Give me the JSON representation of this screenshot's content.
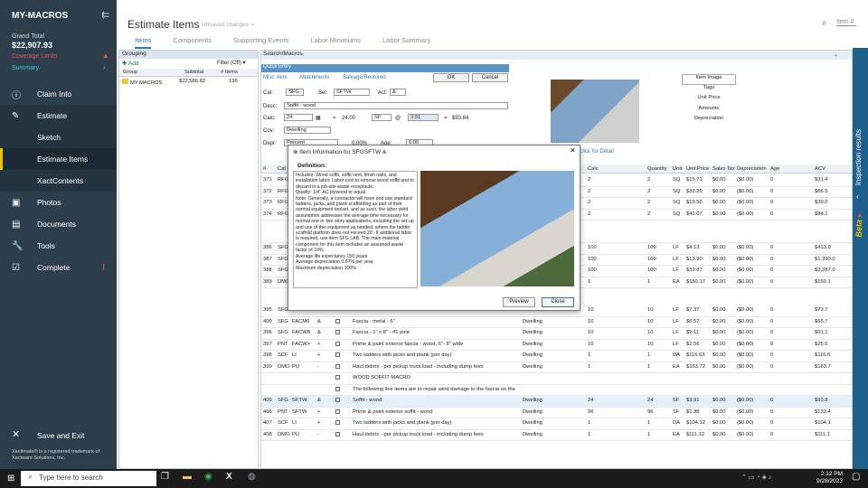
{
  "sidebar": {
    "app_title": "MY-MACROS",
    "collapse_icon": "⇇",
    "grand_total_label": "Grand Total",
    "grand_total_value": "$22,907.93",
    "coverage_limits": "Coverage Limits",
    "summary": "Summary",
    "items": [
      {
        "label": "Claim Info",
        "icon": "info-icon"
      },
      {
        "label": "Estimate",
        "icon": "pencil-icon"
      },
      {
        "label": "Sketch"
      },
      {
        "label": "Estimate Items"
      },
      {
        "label": "XactContents"
      },
      {
        "label": "Photos",
        "icon": "photos-icon"
      },
      {
        "label": "Documents",
        "icon": "documents-icon"
      },
      {
        "label": "Tools",
        "icon": "wrench-icon"
      },
      {
        "label": "Complete",
        "icon": "check-icon"
      }
    ],
    "save_exit": "Save and Exit",
    "trademark": "Xactimate® is a registered trademark of Xactware Solutions, Inc."
  },
  "header": {
    "title": "Estimate Items",
    "unsaved": "Unsaved changes",
    "tabs": [
      "Items",
      "Components",
      "Supporting Events",
      "Labor Minimums",
      "Labor Summary"
    ],
    "item_search_placeholder": "Item #"
  },
  "right_strip": {
    "inspection": "Inspection results",
    "beta": "Beta"
  },
  "grouping": {
    "title": "Grouping",
    "add": "Add",
    "filter": "Filter (Off)",
    "cols": [
      "Group",
      "Subtotal",
      "# Items"
    ],
    "row": {
      "group": "MY-MACROS",
      "subtotal": "$22,586.82",
      "items": "136"
    }
  },
  "search_macros": "Search/Macros",
  "quick_entry": {
    "title": "Quick Entry",
    "subtabs": [
      "Misc",
      "Item",
      "Attachments",
      "Salvage/Restored"
    ],
    "ok": "OK",
    "cancel": "Cancel",
    "cat_label": "Cat:",
    "cat": "SFG",
    "sel_label": "Sel:",
    "sel": "SFTW",
    "act_label": "Act:",
    "act": "&",
    "desc_label": "Desc:",
    "desc": "Soffit - wood",
    "calc_label": "Calc:",
    "calc": "24",
    "calc_result": "24.00",
    "unit": "SF",
    "at": "@",
    "price": "3.91",
    "eq": "=",
    "total": "$93.84",
    "cov_label": "Cov:",
    "cov": "Dwelling",
    "depr_label": "Depr:",
    "depr": "Percent",
    "depr_pct": "0.00%",
    "age_label": "Age:",
    "age": "0.00",
    "image_tabs": [
      "Item Image",
      "Tags",
      "Unit Price",
      "Amounts",
      "Depreciation"
    ],
    "click_detail": "Click for Detail"
  },
  "line_items": {
    "cols": [
      "#",
      "Cat",
      "Calc",
      "Quantity",
      "Unit",
      "Unit Price",
      "Sales Tax",
      "Depreciation",
      "Age",
      "ACV"
    ],
    "rows": [
      {
        "n": "371",
        "cat": "RFG",
        "calc": "2",
        "qty": "2",
        "unit": "SQ",
        "price": "$15.71",
        "tax": "$0.00",
        "dep": "($0.00)",
        "age": "0",
        "acv": "$31.4"
      },
      {
        "n": "372",
        "cat": "RFG",
        "calc": "2",
        "qty": "2",
        "unit": "SQ",
        "price": "$33.26",
        "tax": "$0.00",
        "dep": "($0.00)",
        "age": "0",
        "acv": "$66.5"
      },
      {
        "n": "373",
        "cat": "RFG",
        "calc": "2",
        "qty": "2",
        "unit": "SQ",
        "price": "$19.50",
        "tax": "$0.00",
        "dep": "($0.00)",
        "age": "0",
        "acv": "$39.0"
      },
      {
        "n": "374",
        "cat": "RFG",
        "calc": "2",
        "qty": "2",
        "unit": "SQ",
        "price": "$42.07",
        "tax": "$0.00",
        "dep": "($0.00)",
        "age": "0",
        "acv": "$84.1"
      },
      {
        "n": "",
        "cat": "",
        "calc": "",
        "qty": "",
        "unit": "",
        "price": "",
        "tax": "",
        "dep": "",
        "age": "",
        "acv": ""
      },
      {
        "n": "386",
        "cat": "SFG",
        "calc": "100",
        "qty": "100",
        "unit": "LF",
        "price": "$4.13",
        "tax": "$0.00",
        "dep": "($0.00)",
        "age": "0",
        "acv": "$413.0"
      },
      {
        "n": "387",
        "cat": "SFG",
        "calc": "100",
        "qty": "100",
        "unit": "LF",
        "price": "$13.90",
        "tax": "$0.00",
        "dep": "($0.00)",
        "age": "0",
        "acv": "$1,390.0"
      },
      {
        "n": "388",
        "cat": "SFG",
        "calc": "100",
        "qty": "100",
        "unit": "LF",
        "price": "$32.87",
        "tax": "$0.00",
        "dep": "($0.00)",
        "age": "0",
        "acv": "$3,287.0"
      },
      {
        "n": "389",
        "cat": "DMO",
        "calc": "1",
        "qty": "1",
        "unit": "EA",
        "price": "$150.17",
        "tax": "$0.00",
        "dep": "($0.00)",
        "age": "0",
        "acv": "$150.1"
      }
    ],
    "rows2": [
      {
        "n": "395",
        "cat": "SFG",
        "sel": "",
        "act": "",
        "desc": "",
        "calc": "10",
        "qty": "10",
        "unit": "LF",
        "price": "$7.37",
        "tax": "$0.00",
        "dep": "($0.00)",
        "age": "0",
        "acv": "$73.7"
      },
      {
        "n": "400",
        "cat": "SFG",
        "sel": "FACM6",
        "act": "&",
        "desc": "Fascia - metal - 6\"",
        "cov": "Dwelling",
        "calc": "10",
        "qty": "10",
        "unit": "LF",
        "price": "$6.57",
        "tax": "$0.00",
        "dep": "($0.00)",
        "age": "0",
        "acv": "$65.7"
      },
      {
        "n": "396",
        "cat": "SFG",
        "sel": "FACW8",
        "act": "&",
        "desc": "Fascia - 1\" x 8\" - #1 pine",
        "cov": "Dwelling",
        "calc": "10",
        "qty": "10",
        "unit": "LF",
        "price": "$9.11",
        "tax": "$0.00",
        "dep": "($0.00)",
        "age": "0",
        "acv": "$91.1"
      },
      {
        "n": "397",
        "cat": "PNT",
        "sel": "FACW>",
        "act": "+",
        "desc": "Prime & paint exterior fascia - wood, 6\"- 8\" wide",
        "cov": "Dwelling",
        "calc": "10",
        "qty": "10",
        "unit": "LF",
        "price": "$2.56",
        "tax": "$0.00",
        "dep": "($0.00)",
        "age": "0",
        "acv": "$25.6"
      },
      {
        "n": "398",
        "cat": "SCF",
        "sel": "LI",
        "act": "+",
        "desc": "Two ladders with jacks and plank (per day)",
        "cov": "Dwelling",
        "calc": "1",
        "qty": "1",
        "unit": "DA",
        "price": "$116.63",
        "tax": "$0.00",
        "dep": "($0.00)",
        "age": "0",
        "acv": "$116.6"
      },
      {
        "n": "399",
        "cat": "DMO",
        "sel": "PU",
        "act": "-",
        "desc": "Haul debris - per pickup truck load - including dump fees",
        "cov": "Dwelling",
        "calc": "1",
        "qty": "1",
        "unit": "EA",
        "price": "$163.72",
        "tax": "$0.00",
        "dep": "($0.00)",
        "age": "0",
        "acv": "$163.7"
      }
    ],
    "macro_title": "WOOD SOFFIT MACRO",
    "macro_note": "The following line items are to repair wind damage to the fascia on the",
    "rows3": [
      {
        "n": "405",
        "cat": "SFG",
        "sel": "SFTW",
        "act": "&",
        "desc": "Soffit - wood",
        "cov": "Dwelling",
        "calc": "24",
        "qty": "24",
        "unit": "SF",
        "price": "$3.91",
        "tax": "$0.00",
        "dep": "($0.00)",
        "age": "0",
        "acv": "$93.8"
      },
      {
        "n": "406",
        "cat": "PNT",
        "sel": "SFTW",
        "act": "+",
        "desc": "Prime & paint exterior soffit - wood",
        "cov": "Dwelling",
        "calc": "96",
        "qty": "96",
        "unit": "SF",
        "price": "$1.38",
        "tax": "$0.00",
        "dep": "($0.00)",
        "age": "0",
        "acv": "$132.4"
      },
      {
        "n": "407",
        "cat": "SCF",
        "sel": "LI",
        "act": "+",
        "desc": "Two ladders with jacks and plank (per day)",
        "cov": "Dwelling",
        "calc": "1",
        "qty": "1",
        "unit": "DA",
        "price": "$104.12",
        "tax": "$0.00",
        "dep": "($0.00)",
        "age": "0",
        "acv": "$104.1"
      },
      {
        "n": "408",
        "cat": "DMO",
        "sel": "PU",
        "act": "-",
        "desc": "Haul debris - per pickup truck load - including dump fees",
        "cov": "Dwelling",
        "calc": "1",
        "qty": "1",
        "unit": "EA",
        "price": "$111.12",
        "tax": "$0.00",
        "dep": "($0.00)",
        "age": "0",
        "acv": "$111.1"
      }
    ]
  },
  "modal": {
    "title": "Item Information for SFGSFTW &",
    "definition_label": "Definition:",
    "definition": "Includes: Wood soffit, soffit vent, finish nails, and installation labor. Labor cost to remove wood soffit and to discard in a job-site waste receptacle.\nQuality: 1/4\" AC plywood or equal.\nNote: Generally, a contractor will have and use standard ladders, jacks, and plank scaffolding as part of their normal equipment toolset, and as such, the labor yield assumption addresses the average time necessary for normal one or two story applications, including the set up and use of this equipment as needed, where the ladder scaffold platform does not exceed 20'. If additional labor is required, use item SFG LAB. The main material component for this item includes an assumed waste factor of 10%.\nAverage life expectancy 150 years\nAverage depreciation 0.67% per year\nMaximum depreciation 100%",
    "preview": "Preview",
    "close": "Close"
  },
  "taskbar": {
    "search": "Type here to search",
    "time": "2:12 PM",
    "date": "9/28/2023"
  }
}
